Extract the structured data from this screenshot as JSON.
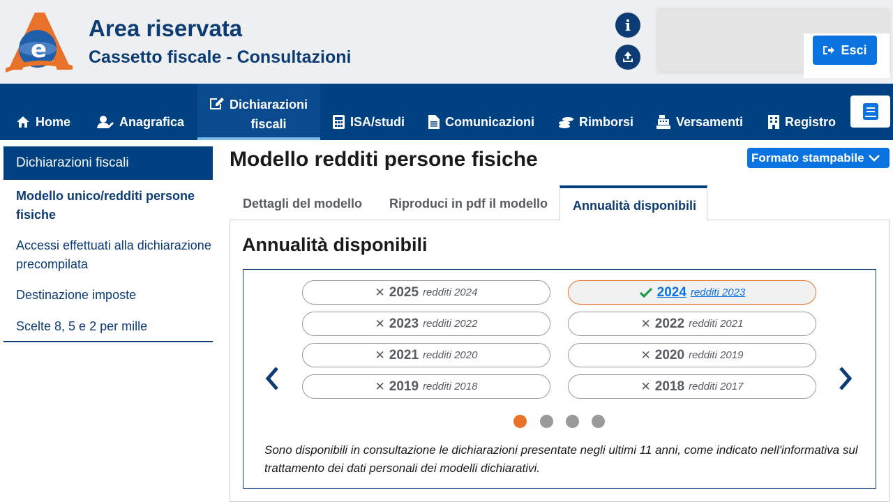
{
  "header": {
    "title": "Area riservata",
    "subtitle": "Cassetto fiscale - Consultazioni",
    "logout_label": "Esci",
    "icons": [
      "info-icon",
      "upload-icon",
      "logout-icon"
    ]
  },
  "nav": {
    "items": [
      {
        "label": "Home",
        "icon": "home-icon"
      },
      {
        "label": "Anagrafica",
        "icon": "user-icon"
      },
      {
        "label_line1": "Dichiarazioni",
        "label_line2": "fiscali",
        "icon": "edit-document-icon"
      },
      {
        "label": "ISA/studi",
        "icon": "calculator-icon"
      },
      {
        "label": "Comunicazioni",
        "icon": "document-icon"
      },
      {
        "label": "Rimborsi",
        "icon": "coins-icon"
      },
      {
        "label": "Versamenti",
        "icon": "cash-register-icon"
      },
      {
        "label": "Registro",
        "icon": "building-icon"
      }
    ],
    "book_icon": "book-icon"
  },
  "sidebar": {
    "heading": "Dichiarazioni fiscali",
    "links": [
      "Modello unico/redditi persone fisiche",
      "Accessi effettuati alla dichiarazione precompilata",
      "Destinazione imposte",
      "Scelte 8, 5 e 2 per mille"
    ]
  },
  "main": {
    "page_title": "Modello redditi persone fisiche",
    "print_label": "Formato stampabile",
    "tabs": [
      "Dettagli del modello",
      "Riproduci in pdf il modello",
      "Annualità disponibili"
    ],
    "active_tab": 2,
    "panel_title": "Annualità disponibili",
    "years": [
      {
        "year": "2025",
        "income": "redditi 2024",
        "available": false
      },
      {
        "year": "2024",
        "income": "redditi 2023",
        "available": true
      },
      {
        "year": "2023",
        "income": "redditi 2022",
        "available": false
      },
      {
        "year": "2022",
        "income": "redditi 2021",
        "available": false
      },
      {
        "year": "2021",
        "income": "redditi 2020",
        "available": false
      },
      {
        "year": "2020",
        "income": "redditi 2019",
        "available": false
      },
      {
        "year": "2019",
        "income": "redditi 2018",
        "available": false
      },
      {
        "year": "2018",
        "income": "redditi 2017",
        "available": false
      }
    ],
    "carousel_pages": 4,
    "carousel_current_page": 1,
    "note": "Sono disponibili in consultazione le dichiarazioni presentate negli ultimi 11 anni, come indicato nell'informativa sul trattamento dei dati personali dei modelli dichiarativi."
  },
  "colors": {
    "primary": "#004182",
    "accent": "#0b73e0",
    "highlight": "#e8722a"
  }
}
